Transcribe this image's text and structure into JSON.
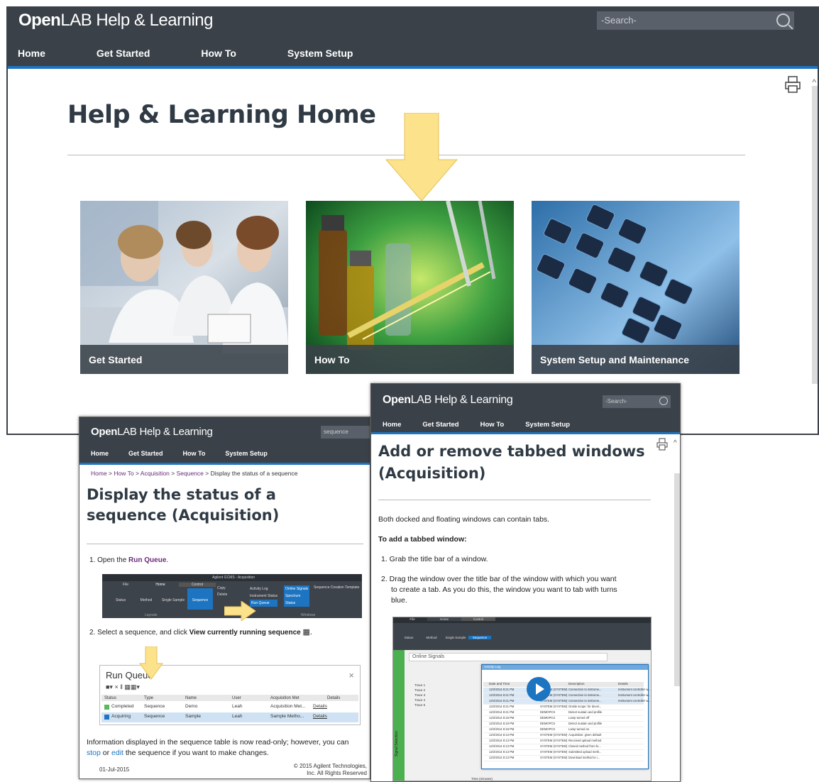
{
  "main": {
    "brand_bold": "Open",
    "brand_rest": "LAB Help & Learning",
    "search_placeholder": "-Search-",
    "nav": [
      "Home",
      "Get Started",
      "How To",
      "System Setup"
    ],
    "page_title": "Help & Learning Home",
    "tiles": [
      "Get Started",
      "How To",
      "System Setup and Maintenance"
    ]
  },
  "left": {
    "brand_bold": "Open",
    "brand_rest": "LAB Help & Learning",
    "search_value": "sequence",
    "nav": [
      "Home",
      "Get Started",
      "How To",
      "System Setup"
    ],
    "breadcrumb": [
      "Home",
      "How To",
      "Acquisition",
      "Sequence"
    ],
    "breadcrumb_current": "Display the status of a sequence",
    "title": "Display the status of a sequence (Acquisition)",
    "step1_prefix": "1. Open the ",
    "step1_link": "Run Queue",
    "step1_suffix": ".",
    "ribbon_app_title": "Agilent GCMS - Acquisition",
    "ribbon_tabs": [
      "File",
      "Home",
      "Control"
    ],
    "ribbon_items": [
      "Status",
      "Method",
      "Single Sample",
      "Sequence"
    ],
    "ribbon_side": [
      "Copy",
      "Delete"
    ],
    "ribbon_col1": [
      "Activity Log",
      "Instrument Status",
      "Run Queue"
    ],
    "ribbon_col2": [
      "Online Signals",
      "Spectrum",
      "Status"
    ],
    "ribbon_col3": "Sequence Creation Template",
    "ribbon_groups": [
      "Layouts",
      "Windows"
    ],
    "step2_prefix": "2. Select a sequence, and click ",
    "step2_bold": "View currently running sequence",
    "runqueue_title": "Run Queue",
    "runqueue_close": "×",
    "runqueue_headers": [
      "Status",
      "Type",
      "Name",
      "User",
      "Acquisition Met",
      "Details"
    ],
    "runqueue_rows": [
      [
        "Completed",
        "Sequence",
        "Demo",
        "Leah",
        "Acquisition Met...",
        "Details"
      ],
      [
        "Acquiring",
        "Sequence",
        "Sample",
        "Leah",
        "Sample Metho...",
        "Details"
      ]
    ],
    "info_text_1": "Information displayed in the sequence table is now read-only; however, you can",
    "info_link_stop": "stop",
    "info_or": " or ",
    "info_link_edit": "edit",
    "info_text_2": " the sequence if you want to make changes.",
    "footer_date": "01-Jul-2015",
    "footer_copy_1": "© 2015 Agilent Technologies,",
    "footer_copy_2": "Inc. All Rights Reserved"
  },
  "right": {
    "brand_bold": "Open",
    "brand_rest": "LAB Help & Learning",
    "search_placeholder": "-Search-",
    "nav": [
      "Home",
      "Get Started",
      "How To",
      "System Setup"
    ],
    "title": "Add or remove tabbed windows (Acquisition)",
    "intro": "Both docked and floating windows can contain tabs.",
    "subheading": "To add a tabbed window:",
    "step1": "1. Grab the title bar of a window.",
    "step2_line1": "2. Drag the window over the title bar of the window with which you want",
    "step2_line2": "to create a tab. As you do this, the window you want to tab with turns",
    "step2_line3": "blue.",
    "shot_ribbon_tabs": [
      "File",
      "Home",
      "Control"
    ],
    "shot_ribbon_items": [
      "Status",
      "Method",
      "Single Sample",
      "Sequence"
    ],
    "shot_panel_title": "Online Signals",
    "shot_float_title": "Activity Log",
    "shot_legend": [
      "Trace 1",
      "Trace 2",
      "Trace 3",
      "Trace 4",
      "Trace 5"
    ],
    "shot_col_headers": [
      "Date and Time",
      "User",
      "Description",
      "Details"
    ],
    "shot_log_rows": [
      [
        "12/2/2014 8:21 PM",
        "SYSTEM (SYSTEM)",
        "Connection to instrume...",
        "Instrument controller w..."
      ],
      [
        "12/2/2014 8:21 PM",
        "SYSTEM (SYSTEM)",
        "Connection to instrume...",
        "Instrument controller w..."
      ],
      [
        "12/2/2014 8:21 PM",
        "SYSTEM (SYSTEM)",
        "Connection to instrume...",
        "Instrument controller w..."
      ],
      [
        "12/2/2014 8:21 PM",
        "SYSTEM (SYSTEM)",
        "Onsite scope: for devel...",
        ""
      ],
      [
        "12/2/2014 8:21 PM",
        "DEMOPCS",
        "Detect sustain and profile",
        ""
      ],
      [
        "12/2/2014 8:18 PM",
        "DEMOPCS",
        "Lamp turned off",
        ""
      ],
      [
        "12/2/2014 8:18 PM",
        "DEMOPCS",
        "Detect sustain and profile",
        ""
      ],
      [
        "12/2/2014 8:18 PM",
        "DEMOPCS",
        "Lamp turned on",
        ""
      ],
      [
        "12/2/2014 8:13 PM",
        "SYSTEM (SYSTEM)",
        "Acquisition: given default",
        ""
      ],
      [
        "12/2/2014 8:13 PM",
        "SYSTEM (SYSTEM)",
        "Received upload method",
        ""
      ],
      [
        "12/2/2014 8:13 PM",
        "SYSTEM (SYSTEM)",
        "Closed method from fo...",
        ""
      ],
      [
        "12/2/2014 8:13 PM",
        "SYSTEM (SYSTEM)",
        "Submitted upload meth...",
        ""
      ],
      [
        "12/2/2014 8:13 PM",
        "SYSTEM (SYSTEM)",
        "Download method to i...",
        ""
      ]
    ],
    "shot_axis_label": "Time (minutes)",
    "shot_side_label": "Signal Selection"
  }
}
